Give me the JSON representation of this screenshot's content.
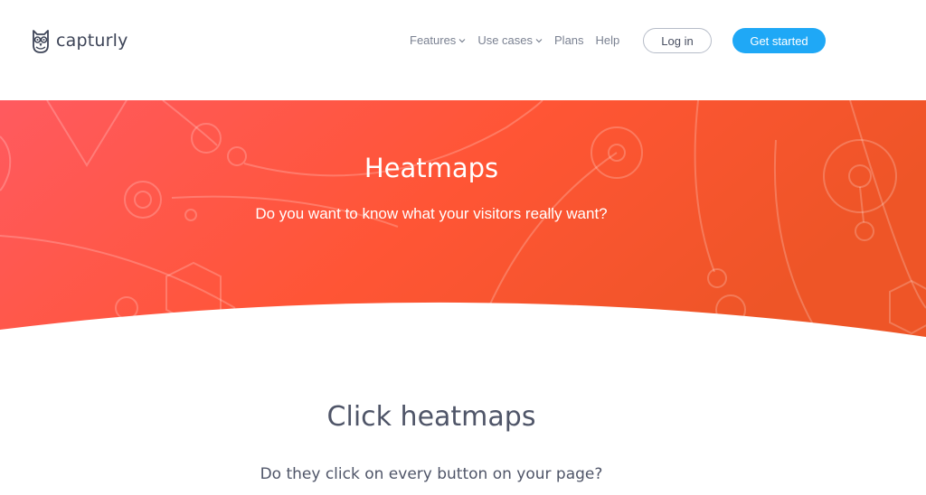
{
  "brand": {
    "name": "capturly",
    "logo_icon": "owl-logo-icon",
    "text_color": "#3d4457"
  },
  "nav": {
    "items": [
      {
        "label": "Features",
        "has_dropdown": true
      },
      {
        "label": "Use cases",
        "has_dropdown": true
      },
      {
        "label": "Plans",
        "has_dropdown": false
      },
      {
        "label": "Help",
        "has_dropdown": false
      }
    ],
    "login_label": "Log in",
    "cta_label": "Get started",
    "cta_color": "#1fa8f6"
  },
  "hero": {
    "title": "Heatmaps",
    "subtitle": "Do you want to know what your visitors really want?",
    "gradient_start": "#ff5a5f",
    "gradient_end": "#f0572a"
  },
  "section": {
    "title": "Click heatmaps",
    "subtitle": "Do they click on every button on your page?"
  }
}
